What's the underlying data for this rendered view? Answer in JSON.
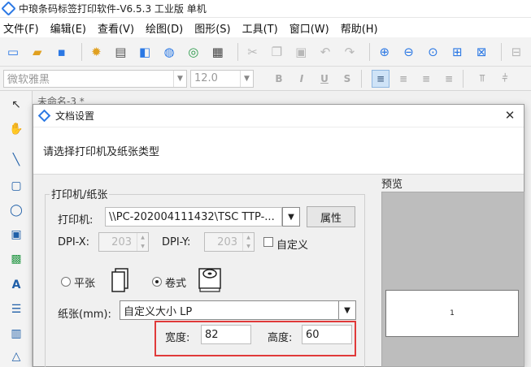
{
  "window": {
    "title": "中琅条码标签打印软件-V6.5.3 工业版 单机"
  },
  "menu": [
    "文件(F)",
    "编辑(E)",
    "查看(V)",
    "绘图(D)",
    "图形(S)",
    "工具(T)",
    "窗口(W)",
    "帮助(H)"
  ],
  "font_toolbar": {
    "font_name": "微软雅黑",
    "font_size": "12.0",
    "bold": "B",
    "italic": "I",
    "underline": "U",
    "strike": "S"
  },
  "doc_tab": {
    "label": "未命名-3 *"
  },
  "dialog": {
    "title": "文档设置",
    "prompt": "请选择打印机及纸张类型",
    "group_title": "打印机/纸张",
    "printer_label": "打印机:",
    "printer_value": "\\\\PC-202004111432\\TSC TTP-...",
    "properties_button": "属性",
    "dpi_x_label": "DPI-X:",
    "dpi_x_value": "203",
    "dpi_y_label": "DPI-Y:",
    "dpi_y_value": "203",
    "custom_label": "自定义",
    "custom_checked": false,
    "sheet_label": "平张",
    "roll_label": "卷式",
    "selected_type": "卷式",
    "paper_label": "纸张(mm):",
    "paper_value": "自定义大小 LP",
    "width_label": "宽度:",
    "width_value": "82",
    "height_label": "高度:",
    "height_value": "60",
    "preview_label": "预览",
    "preview_page_number": "1",
    "close_symbol": "✕"
  },
  "colors": {
    "accent": "#2b78e4",
    "highlight": "#e03a3a",
    "preview_bg": "#bdbdbd"
  }
}
